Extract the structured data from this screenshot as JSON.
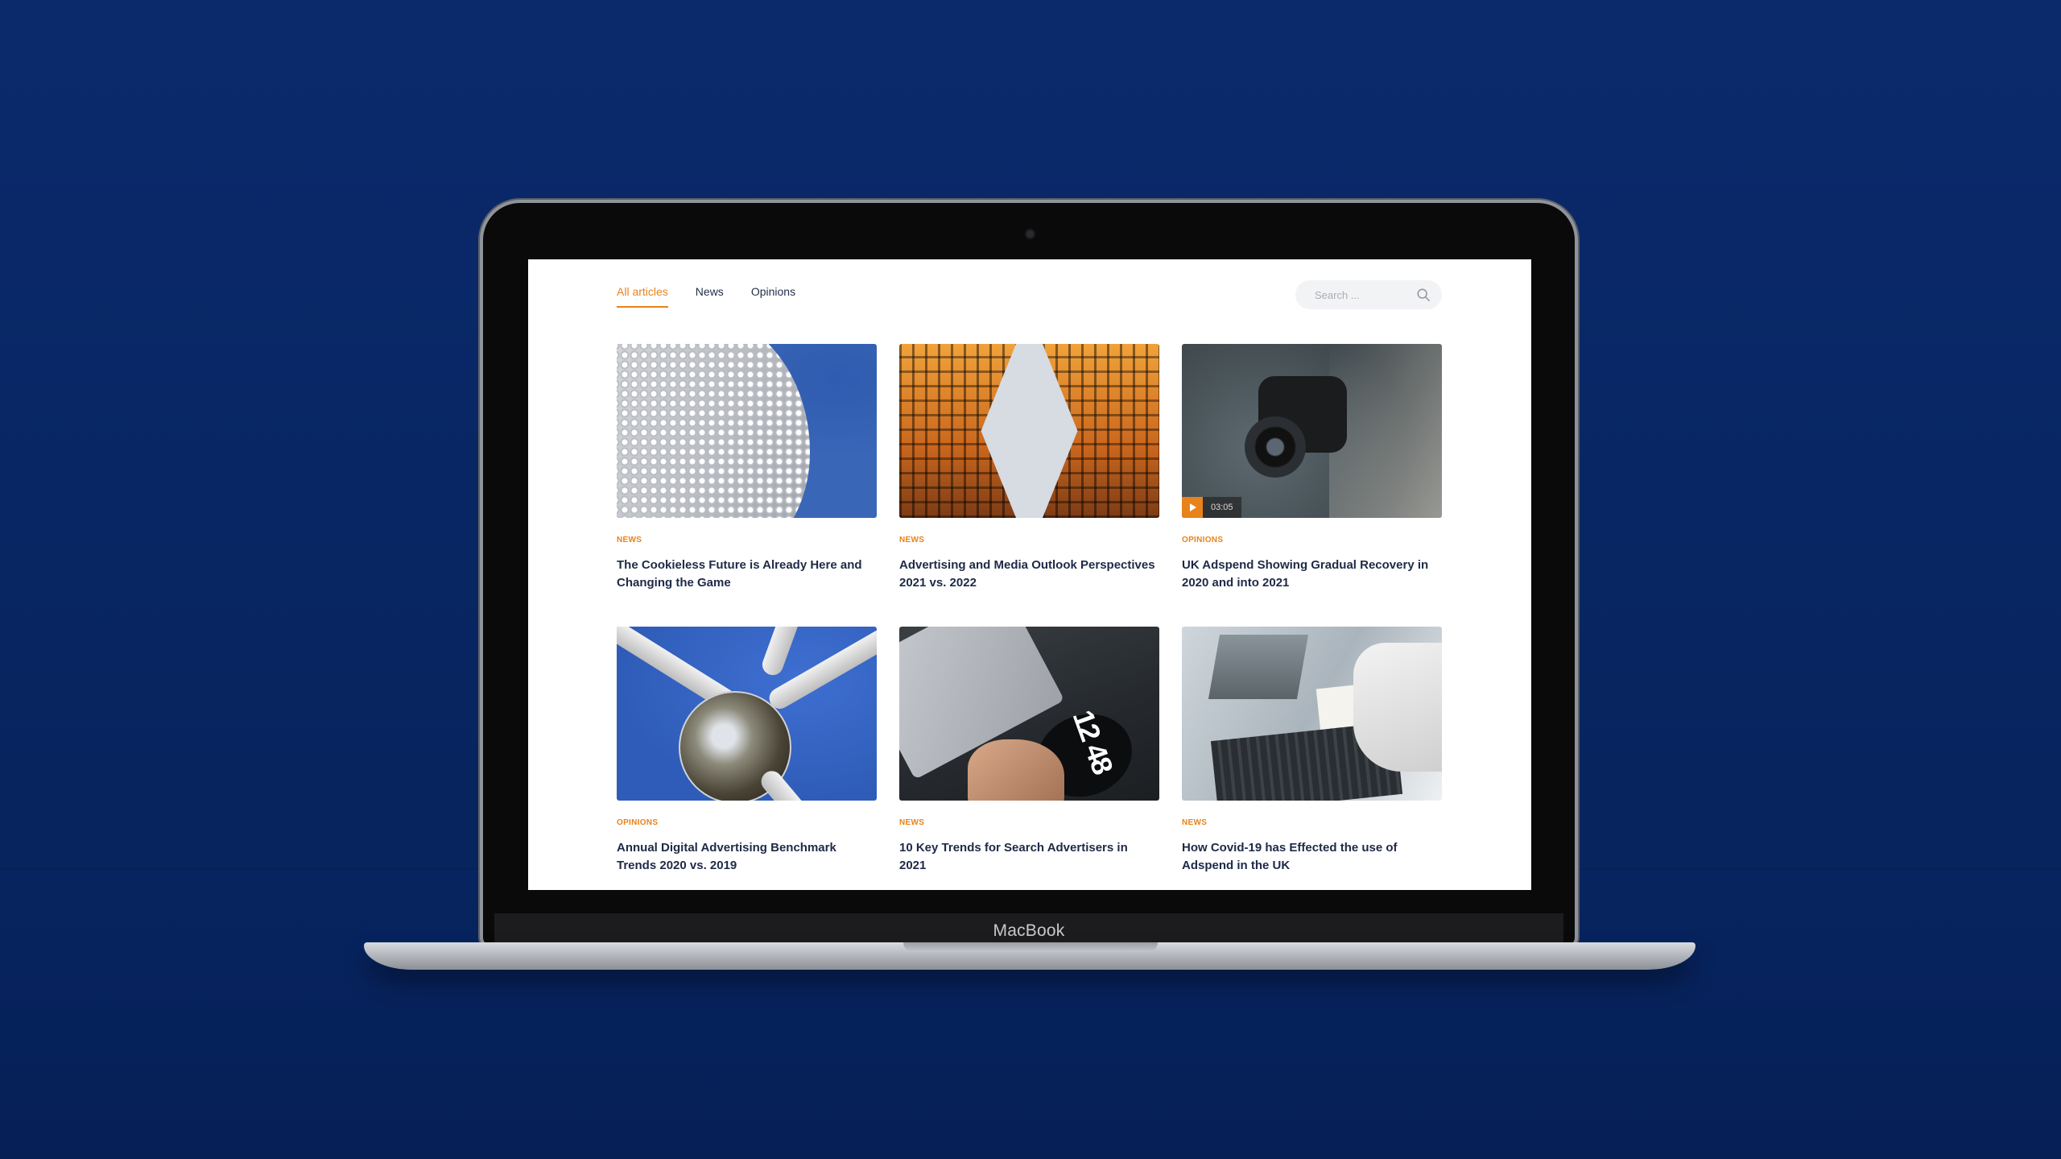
{
  "screen": {
    "tabs": [
      {
        "label": "All articles",
        "active": true
      },
      {
        "label": "News",
        "active": false
      },
      {
        "label": "Opinions",
        "active": false
      }
    ],
    "search": {
      "placeholder": "Search ..."
    },
    "articles": [
      {
        "category": "NEWS",
        "title": "The Cookieless Future is Already Here and Changing the Game"
      },
      {
        "category": "NEWS",
        "title": "Advertising and Media Outlook Perspectives 2021 vs. 2022"
      },
      {
        "category": "OPINIONS",
        "title": "UK Adspend Showing Gradual Recovery in 2020 and into 2021",
        "video_duration": "03:05"
      },
      {
        "category": "OPINIONS",
        "title": "Annual Digital Advertising Benchmark Trends 2020 vs. 2019"
      },
      {
        "category": "NEWS",
        "title": "10 Key Trends for Search Advertisers in 2021"
      },
      {
        "category": "NEWS",
        "title": "How Covid-19 has Effected the use of Adspend in the UK"
      }
    ]
  },
  "device": {
    "brand_label": "MacBook"
  },
  "colors": {
    "accent": "#e8821a",
    "heading": "#1e2a47",
    "background": "#082663"
  },
  "thumb_5_text": "12 48"
}
